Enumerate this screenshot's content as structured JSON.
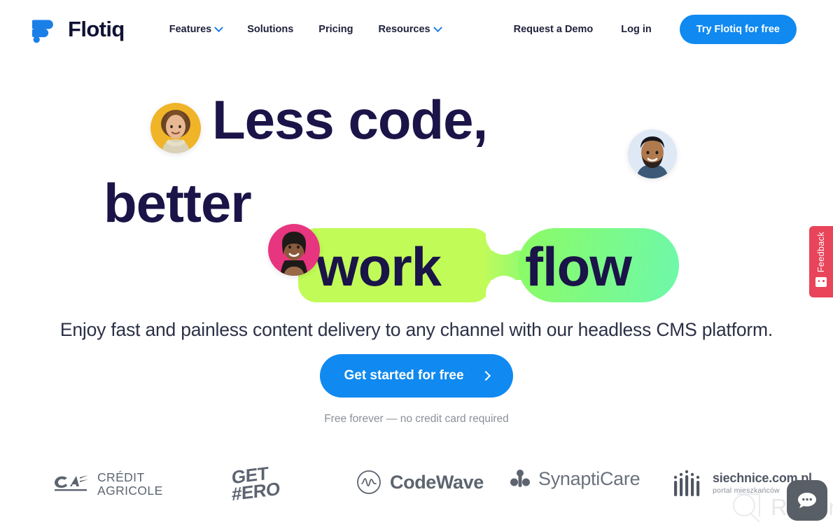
{
  "header": {
    "brand_name": "Flotiq",
    "logo_icon": "flotiq-node-logo",
    "nav": [
      {
        "label": "Features",
        "has_dropdown": true
      },
      {
        "label": "Solutions",
        "has_dropdown": false
      },
      {
        "label": "Pricing",
        "has_dropdown": false
      },
      {
        "label": "Resources",
        "has_dropdown": true
      }
    ],
    "request_demo_label": "Request a Demo",
    "login_label": "Log in",
    "try_button_label": "Try Flotiq for free"
  },
  "hero": {
    "headline_line1": "Less code,",
    "headline_line2": "better",
    "headline_word_work": "work",
    "headline_word_flow": "flow",
    "subtitle": "Enjoy fast and painless content delivery to any channel with our headless CMS platform.",
    "cta_label": "Get started for free",
    "cta_icon": "chevron-right-icon",
    "cta_note": "Free forever — no credit card required",
    "avatars": [
      {
        "name": "avatar-woman-curly-hair",
        "bg": "#f0b429"
      },
      {
        "name": "avatar-man-beard",
        "bg": "#dfe8f5"
      },
      {
        "name": "avatar-woman-smiling",
        "bg": "#e8357f"
      }
    ],
    "colors": {
      "headline": "#1a1448",
      "pill_left": "#c1fb58",
      "pill_right_start": "#8cfb63",
      "pill_right_end": "#6df8ab",
      "accent_blue": "#1089f0"
    }
  },
  "logos": {
    "credit_agricole": {
      "line1": "CRÉDIT",
      "line2": "AGRICOLE",
      "icon": "credit-agricole-icon"
    },
    "get_hero": {
      "line1": "GET",
      "line2": "#ERO"
    },
    "codewave": {
      "label": "CodeWave",
      "icon": "wave-circle-icon"
    },
    "synapticare": {
      "label": "SynaptiCare",
      "icon": "synapse-icon"
    },
    "siechnice": {
      "label": "siechnice.com.pl",
      "sub": "portal mieszkańców",
      "icon": "bars-icon"
    }
  },
  "feedback": {
    "label": "Feedback",
    "icon": "smiley-icon",
    "color": "#e8445a"
  },
  "overlay": {
    "watermark_text": "Revain",
    "watermark_icon": "revain-logo-icon",
    "chat_icon": "chat-bubble-icon"
  }
}
